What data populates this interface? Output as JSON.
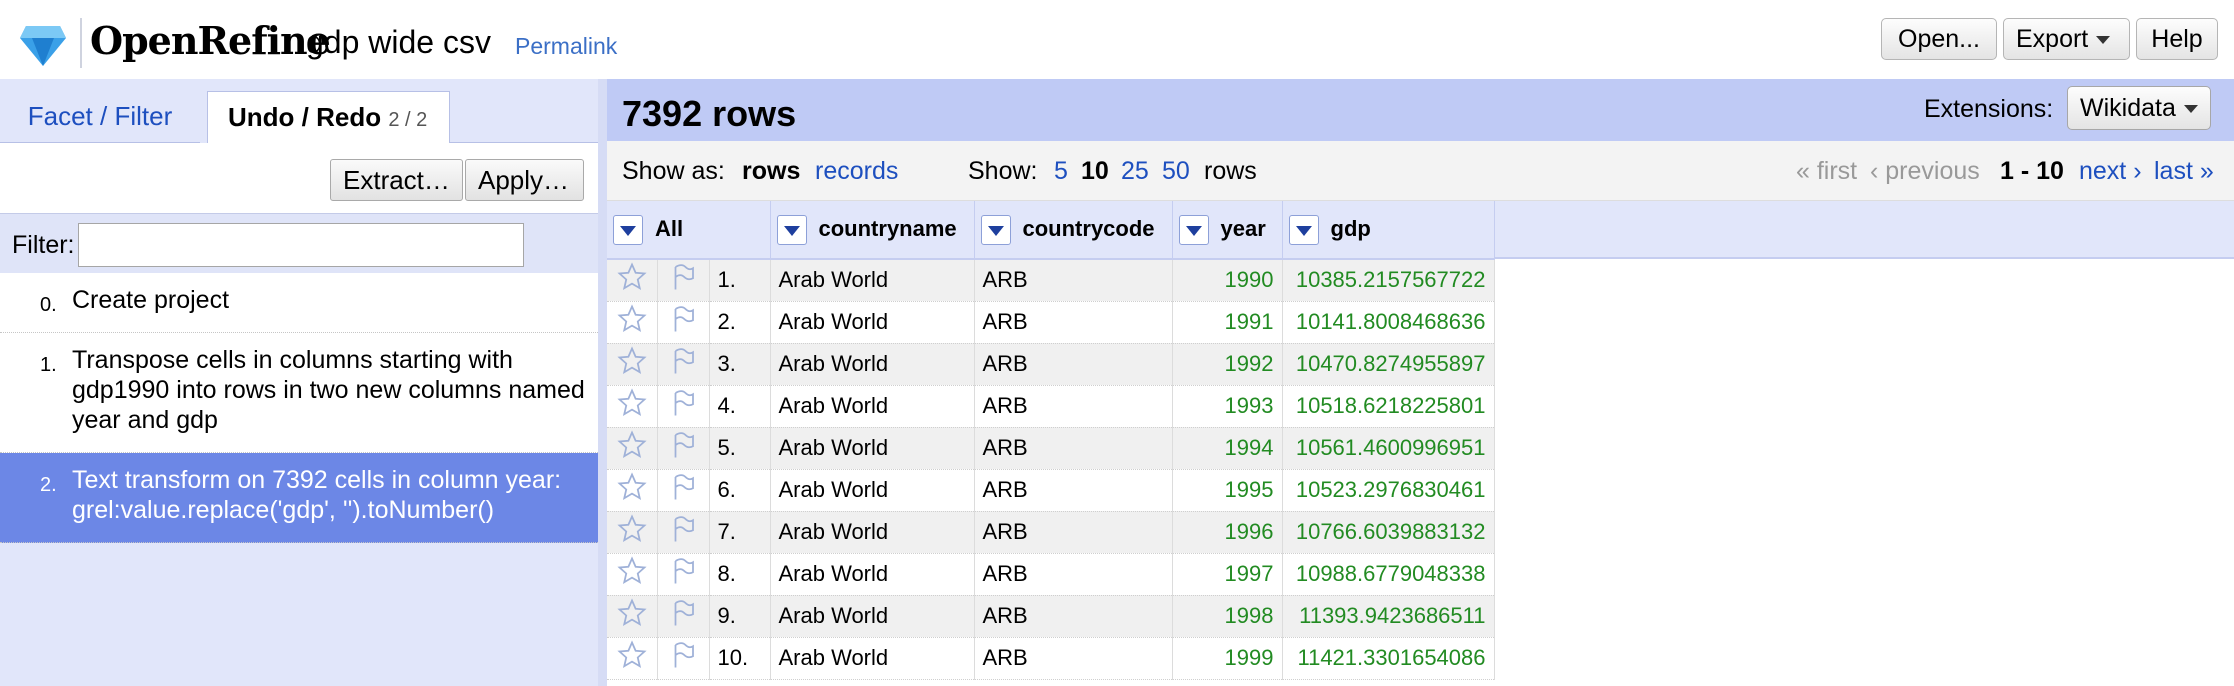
{
  "header": {
    "app_name": "OpenRefine",
    "project_name": "gdp wide csv",
    "permalink": "Permalink",
    "open_label": "Open...",
    "export_label": "Export",
    "help_label": "Help"
  },
  "left_panel": {
    "tabs": [
      {
        "label": "Facet / Filter"
      },
      {
        "label": "Undo / Redo",
        "count": "2 / 2"
      }
    ],
    "extract_label": "Extract…",
    "apply_label": "Apply…",
    "filter_label": "Filter:",
    "filter_value": "",
    "history": [
      {
        "num": "0.",
        "text": "Create project"
      },
      {
        "num": "1.",
        "text": "Transpose cells in columns starting with gdp1990 into rows in two new columns named year and gdp"
      },
      {
        "num": "2.",
        "text": "Text transform on 7392 cells in column year: grel:value.replace('gdp', '').toNumber()"
      }
    ]
  },
  "main": {
    "row_count": "7392 rows",
    "extensions_label": "Extensions:",
    "extensions_value": "Wikidata",
    "show_as_label": "Show as:",
    "show_as_rows": "rows",
    "show_as_records": "records",
    "show_label": "Show:",
    "page_sizes": [
      "5",
      "10",
      "25",
      "50"
    ],
    "page_size_selected": "10",
    "rows_suffix": "rows",
    "pager": {
      "first": "« first",
      "previous": "‹ previous",
      "range": "1 - 10",
      "next": "next ›",
      "last": "last »"
    }
  },
  "table": {
    "columns": [
      "All",
      "countryname",
      "countrycode",
      "year",
      "gdp"
    ],
    "rows": [
      {
        "idx": "1.",
        "countryname": "Arab World",
        "countrycode": "ARB",
        "year": "1990",
        "gdp": "10385.2157567722"
      },
      {
        "idx": "2.",
        "countryname": "Arab World",
        "countrycode": "ARB",
        "year": "1991",
        "gdp": "10141.8008468636"
      },
      {
        "idx": "3.",
        "countryname": "Arab World",
        "countrycode": "ARB",
        "year": "1992",
        "gdp": "10470.8274955897"
      },
      {
        "idx": "4.",
        "countryname": "Arab World",
        "countrycode": "ARB",
        "year": "1993",
        "gdp": "10518.6218225801"
      },
      {
        "idx": "5.",
        "countryname": "Arab World",
        "countrycode": "ARB",
        "year": "1994",
        "gdp": "10561.4600996951"
      },
      {
        "idx": "6.",
        "countryname": "Arab World",
        "countrycode": "ARB",
        "year": "1995",
        "gdp": "10523.2976830461"
      },
      {
        "idx": "7.",
        "countryname": "Arab World",
        "countrycode": "ARB",
        "year": "1996",
        "gdp": "10766.6039883132"
      },
      {
        "idx": "8.",
        "countryname": "Arab World",
        "countrycode": "ARB",
        "year": "1997",
        "gdp": "10988.6779048338"
      },
      {
        "idx": "9.",
        "countryname": "Arab World",
        "countrycode": "ARB",
        "year": "1998",
        "gdp": "11393.9423686511"
      },
      {
        "idx": "10.",
        "countryname": "Arab World",
        "countrycode": "ARB",
        "year": "1999",
        "gdp": "11421.3301654086"
      }
    ]
  },
  "icons": {
    "logo": "diamond-logo-icon",
    "star": "star-icon",
    "flag": "flag-icon",
    "dropdown": "dropdown-arrow-icon"
  },
  "colors": {
    "link": "#1d4fbf",
    "selected": "#6c87e6",
    "number": "#228b22",
    "header_bg": "#bfcaf5"
  }
}
